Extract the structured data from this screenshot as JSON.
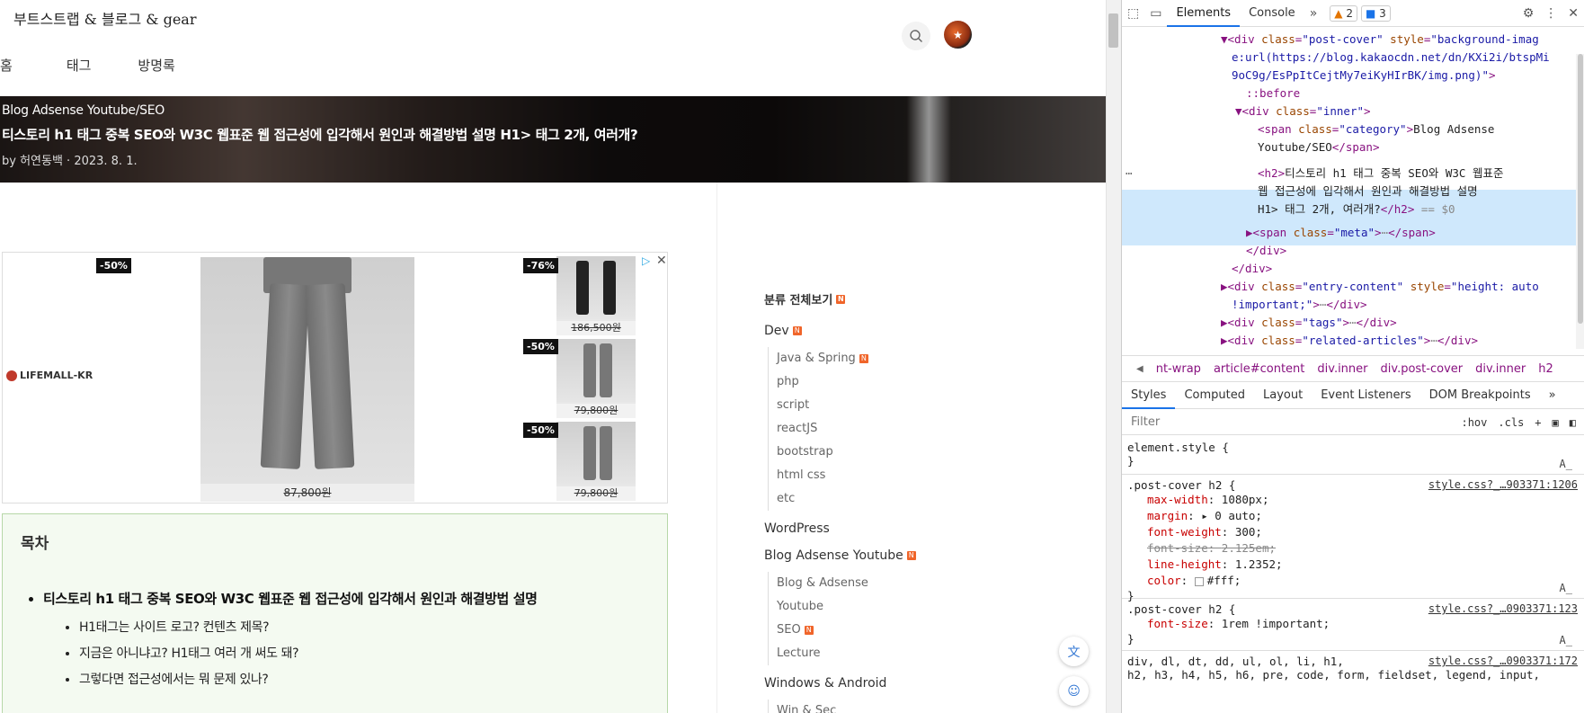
{
  "blog": {
    "site_title": "부트스트랩 & 블로그 & gear",
    "nav": [
      "홈",
      "태그",
      "방명록"
    ],
    "cover": {
      "category": "Blog Adsense Youtube/SEO",
      "title": "티스토리 h1 태그 중복 SEO와 W3C 웹표준 웹 접근성에 입각해서 원인과 해결방법 설명 H1> 태그 2개, 여러개?",
      "meta_by": "by 허연동백 · 2023. 8. 1."
    },
    "ad": {
      "logo": "LIFEMALL-KR",
      "main_badge": "-50%",
      "main_price": "87,800원",
      "thumbs": [
        {
          "badge": "-76%",
          "price": "186,500원"
        },
        {
          "badge": "-50%",
          "price": "79,800원"
        },
        {
          "badge": "-50%",
          "price": "79,800원"
        }
      ]
    },
    "toc": {
      "title": "목차",
      "main_item": "티스토리 h1 태그 중복 SEO와 W3C 웹표준 웹 접근성에 입각해서 원인과 해결방법 설명",
      "sub_items": [
        "H1태그는 사이트 로고? 컨텐츠 제목?",
        "지금은 아니냐고? H1태그 여러 개 써도 돼?",
        "그렇다면 접근성에서는 뭐 문제 있나?"
      ]
    },
    "sidebar": {
      "heading": "분류 전체보기",
      "new_badge": "N",
      "dev": "Dev",
      "dev_sub": [
        "Java & Spring",
        "php",
        "script",
        "reactJS",
        "bootstrap",
        "html css",
        "etc"
      ],
      "wordpress": "WordPress",
      "blog_adsense": "Blog Adsense Youtube",
      "blog_sub": [
        "Blog & Adsense",
        "Youtube",
        "SEO",
        "Lecture"
      ],
      "windows": "Windows & Android",
      "win_sub": [
        "Win & Sec"
      ]
    }
  },
  "devtools": {
    "tabs": [
      "Elements",
      "Console"
    ],
    "warnings": "2",
    "messages": "3",
    "breadcrumbs": [
      "nt-wrap",
      "article#content",
      "div.inner",
      "div.post-cover",
      "div.inner",
      "h2"
    ],
    "style_tabs": [
      "Styles",
      "Computed",
      "Layout",
      "Event Listeners",
      "DOM Breakpoints"
    ],
    "filter_placeholder": "Filter",
    "filter_tools": [
      ":hov",
      ".cls"
    ],
    "rules": {
      "r0": {
        "selector": "element.style {",
        "close": "}"
      },
      "r1": {
        "selector": ".post-cover h2 {",
        "source": "style.css?_…903371:1206",
        "d1": "max-width",
        "v1": "1080px;",
        "d2": "margin",
        "v2": "▸ 0 auto;",
        "d3": "font-weight",
        "v3": "300;",
        "d4": "font-size",
        "v4": "2.125em;",
        "d5": "line-height",
        "v5": "1.2352;",
        "d6": "color",
        "v6": "#fff;",
        "close": "}"
      },
      "r2": {
        "selector": ".post-cover h2 {",
        "source": "style.css?_…0903371:123",
        "d1": "font-size",
        "v1": "1rem !important;",
        "close": "}"
      },
      "r3": {
        "selector": "div, dl, dt, dd, ul, ol, li, h1,",
        "selector2": "h2, h3, h4, h5, h6, pre, code, form, fieldset, legend, input,",
        "source": "style.css?_…0903371:172"
      }
    }
  }
}
